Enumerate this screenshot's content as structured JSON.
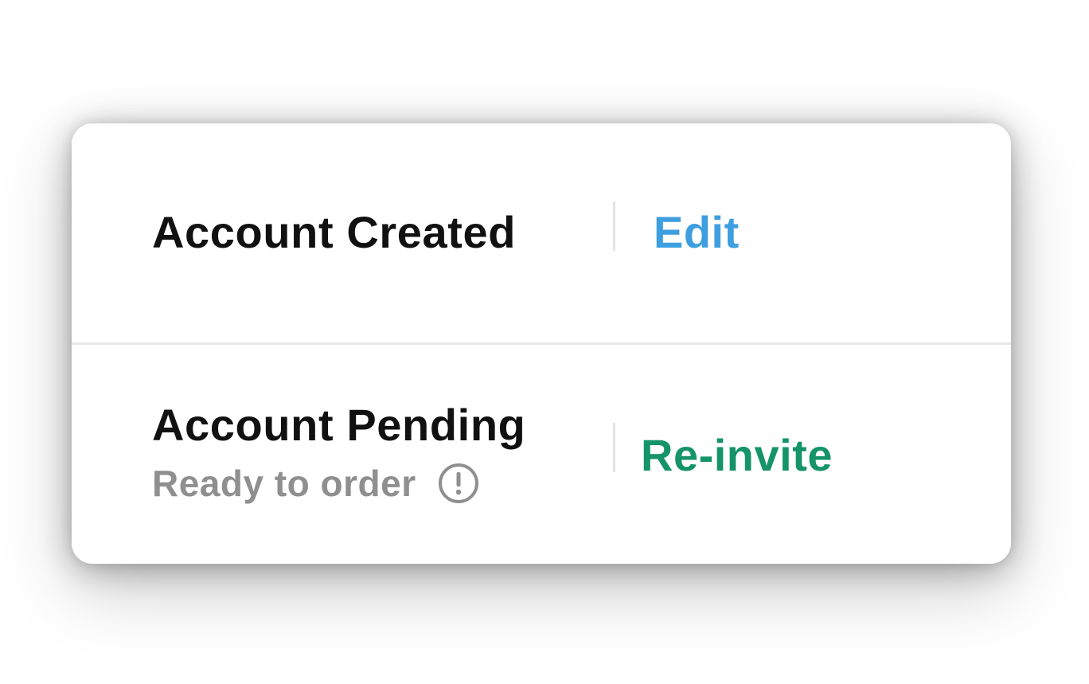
{
  "accounts": {
    "created": {
      "status_label": "Account Created",
      "action_label": "Edit",
      "action_color": "#3d9ee0"
    },
    "pending": {
      "status_label": "Account Pending",
      "sub_label": "Ready to order",
      "sub_icon": "exclamation-circle-icon",
      "action_label": "Re-invite",
      "action_color": "#159369"
    }
  }
}
